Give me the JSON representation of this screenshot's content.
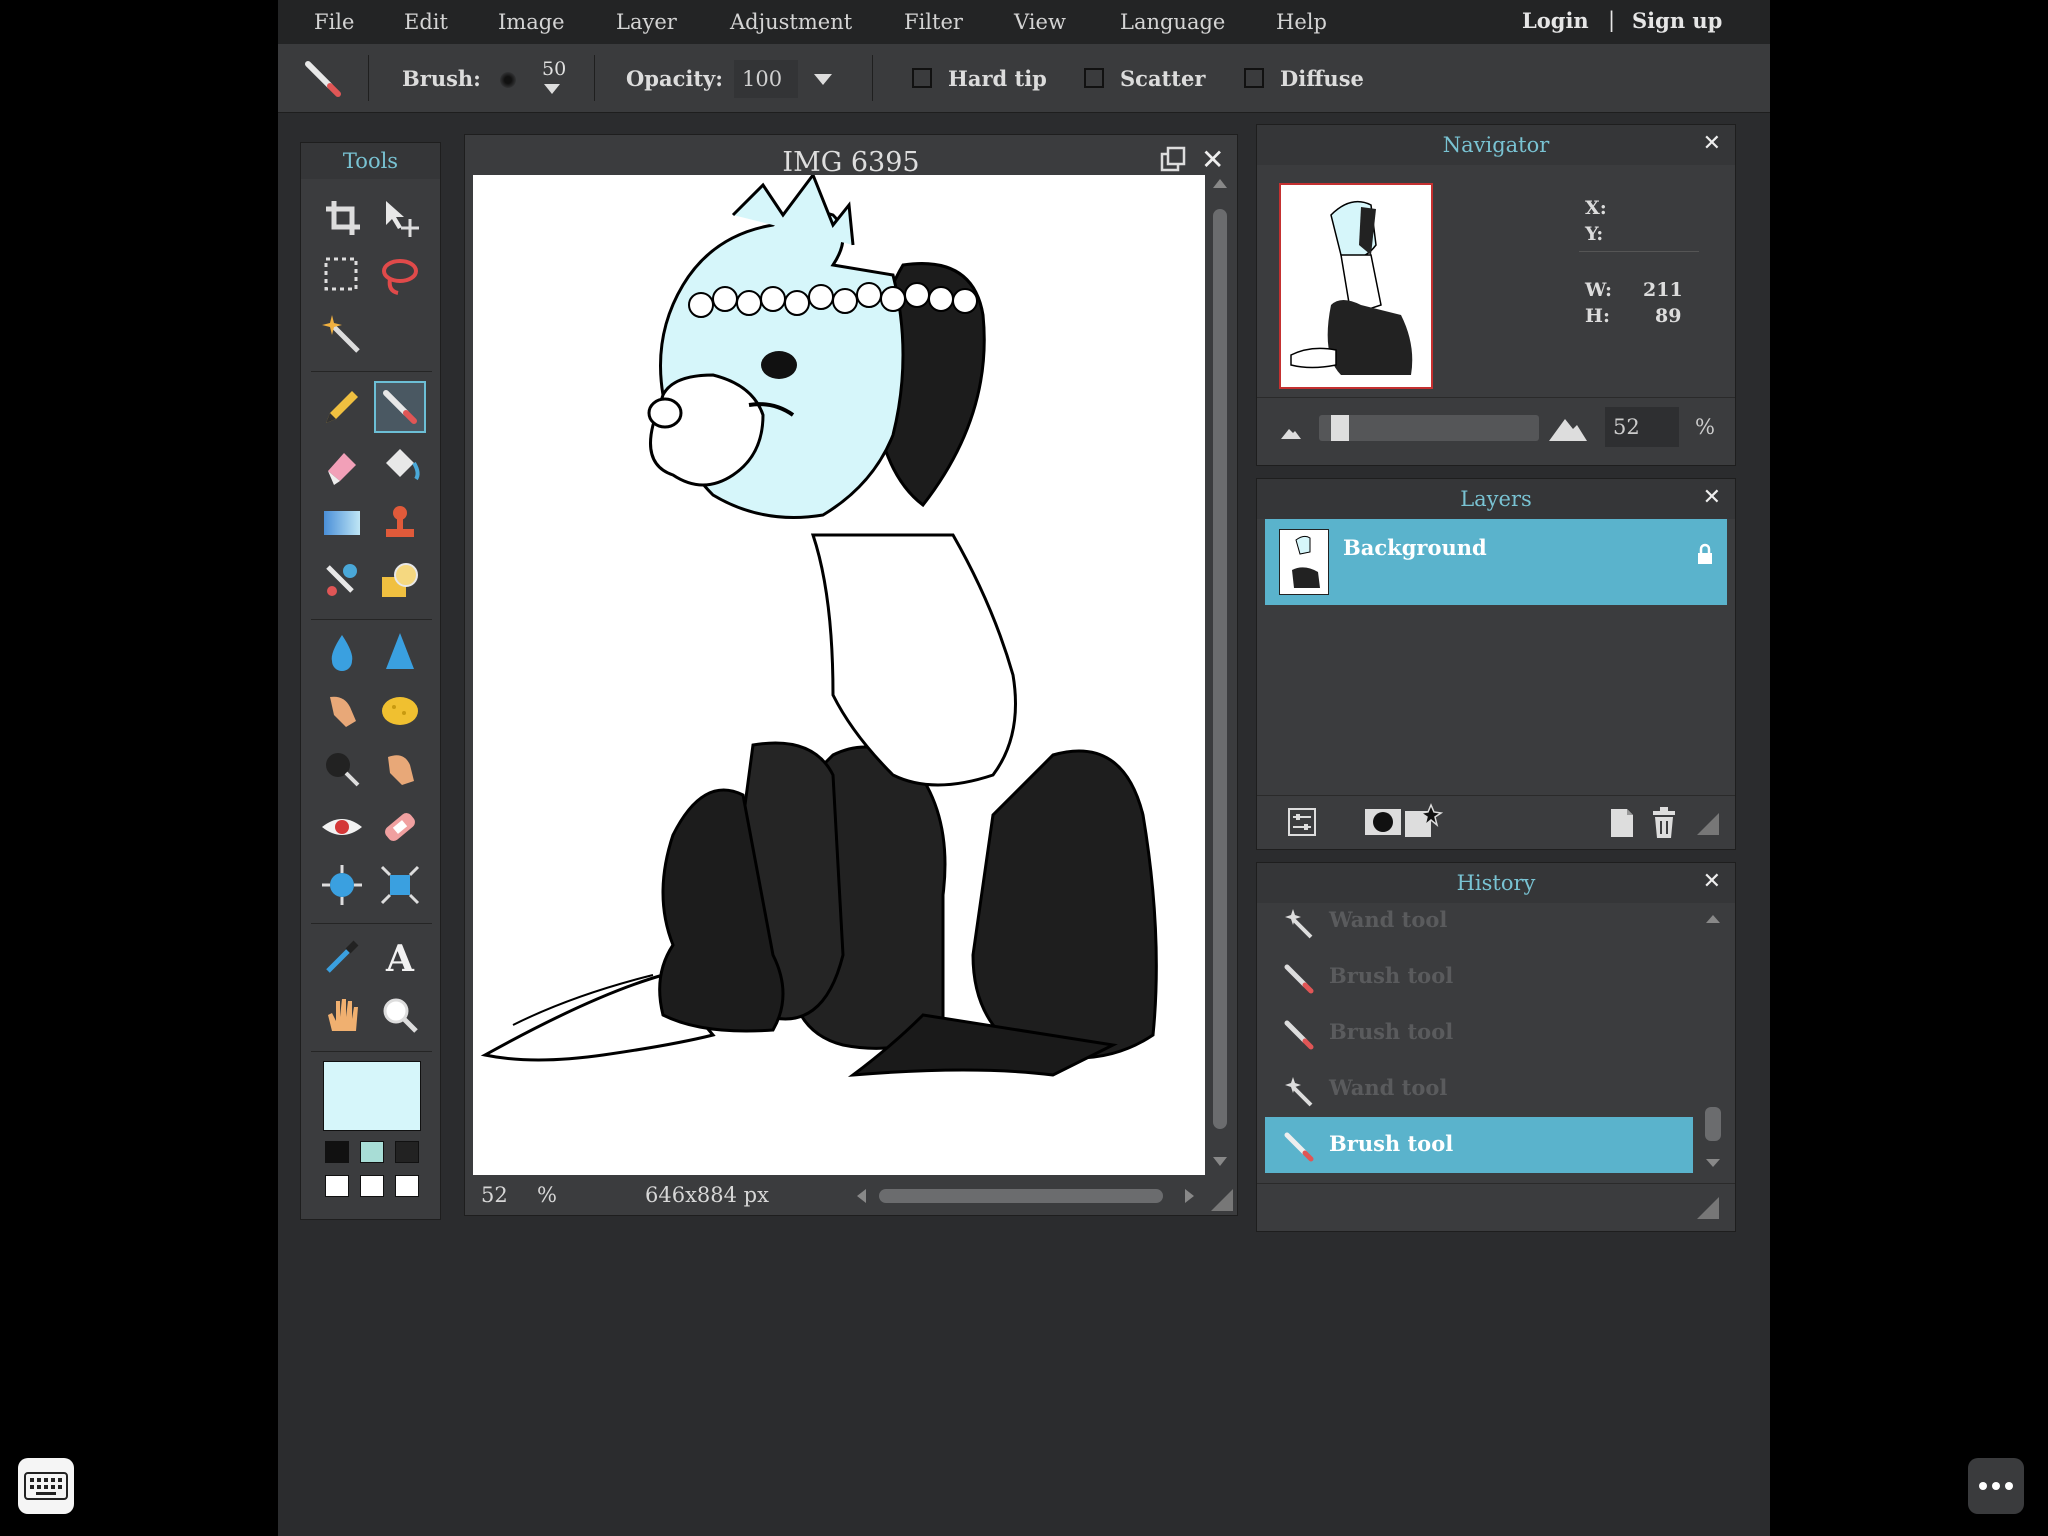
{
  "menu": [
    "File",
    "Edit",
    "Image",
    "Layer",
    "Adjustment",
    "Filter",
    "View",
    "Language",
    "Help"
  ],
  "auth": {
    "login": "Login",
    "separator": "|",
    "signup": "Sign up"
  },
  "options": {
    "brush_label": "Brush:",
    "brush_size": "50",
    "opacity_label": "Opacity:",
    "opacity_value": "100",
    "hard_tip": "Hard tip",
    "scatter": "Scatter",
    "diffuse": "Diffuse"
  },
  "tools": {
    "title": "Tools",
    "active": "brush-tool",
    "primary_color": "#d6f6fa",
    "swatches": [
      "#111111",
      "#a8ddd6",
      "#222222",
      "#ffffff",
      "#ffffff",
      "#ffffff"
    ]
  },
  "document": {
    "title": "IMG 6395",
    "zoom": "52",
    "zoom_unit": "%",
    "dimensions": "646x884 px"
  },
  "navigator": {
    "title": "Navigator",
    "x_label": "X:",
    "y_label": "Y:",
    "w_label": "W:",
    "w_value": "211",
    "h_label": "H:",
    "h_value": "89",
    "zoom": "52",
    "zoom_unit": "%"
  },
  "layers": {
    "title": "Layers",
    "items": [
      {
        "name": "Background",
        "locked": true
      }
    ]
  },
  "history": {
    "title": "History",
    "items": [
      {
        "label": "Wand tool",
        "icon": "wand-icon"
      },
      {
        "label": "Brush tool",
        "icon": "brush-icon"
      },
      {
        "label": "Brush tool",
        "icon": "brush-icon"
      },
      {
        "label": "Wand tool",
        "icon": "wand-icon"
      },
      {
        "label": "Brush tool",
        "icon": "brush-icon",
        "selected": true
      }
    ]
  },
  "colors": {
    "accent": "#5ab3cc",
    "title_text": "#79c3d3",
    "panel_bg": "#3b3c3e"
  }
}
